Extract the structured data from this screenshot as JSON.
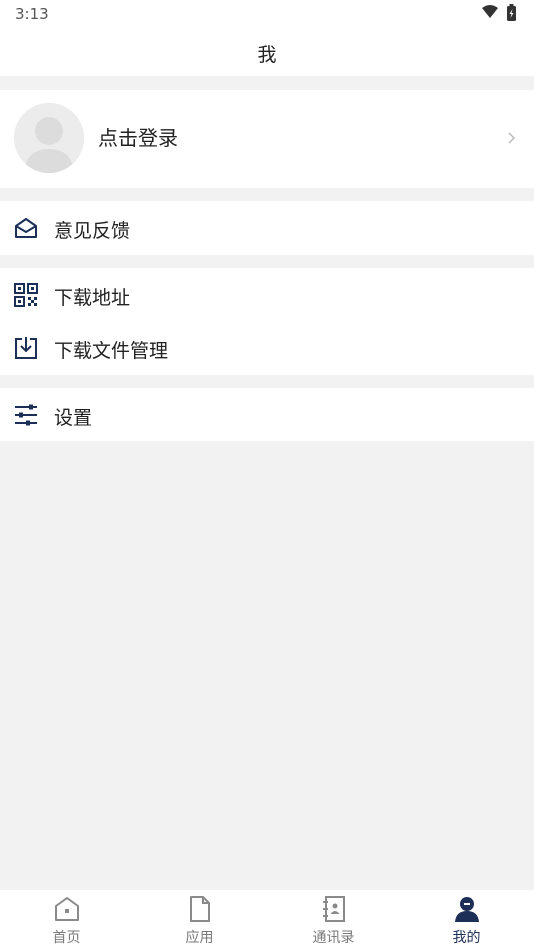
{
  "status_bar": {
    "time": "3:13",
    "wifi_icon": "wifi-icon",
    "battery_icon": "battery-charging-icon"
  },
  "header": {
    "title": "我"
  },
  "profile": {
    "login_label": "点击登录",
    "avatar_icon": "avatar-placeholder-icon",
    "chevron_icon": "chevron-right-icon"
  },
  "menu": {
    "feedback": {
      "label": "意见反馈",
      "icon": "mail-open-icon"
    },
    "download_address": {
      "label": "下载地址",
      "icon": "qr-code-icon"
    },
    "download_files": {
      "label": "下载文件管理",
      "icon": "download-tray-icon"
    },
    "settings": {
      "label": "设置",
      "icon": "sliders-icon"
    }
  },
  "tabs": [
    {
      "label": "首页",
      "icon": "home-icon",
      "active": false
    },
    {
      "label": "应用",
      "icon": "document-icon",
      "active": false
    },
    {
      "label": "通讯录",
      "icon": "contacts-book-icon",
      "active": false
    },
    {
      "label": "我的",
      "icon": "user-icon",
      "active": true
    }
  ],
  "colors": {
    "accent": "#1c2f57",
    "background": "#f2f2f2",
    "surface": "#ffffff",
    "inactive_tab": "#7a7a7a"
  }
}
